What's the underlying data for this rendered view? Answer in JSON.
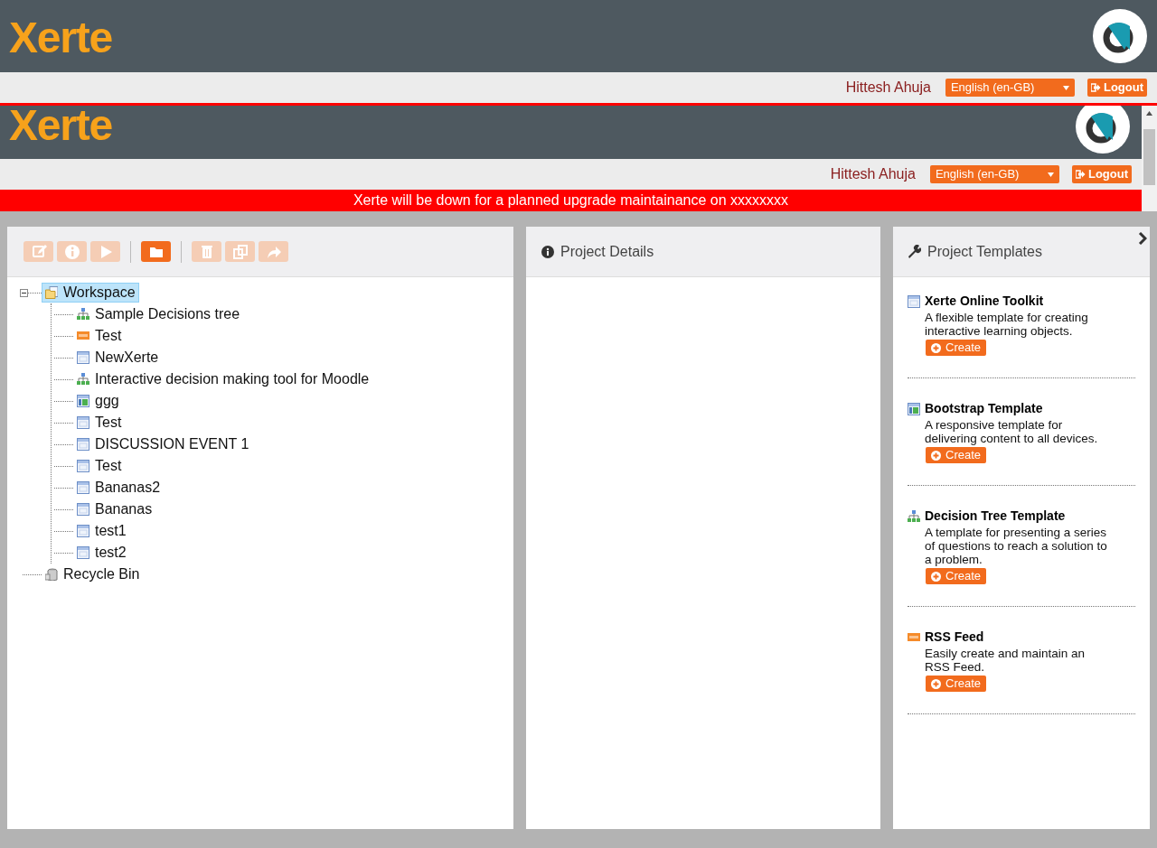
{
  "header": {
    "logo": "Xerte",
    "user": "Hittesh Ahuja",
    "language": "English (en-GB)",
    "logout": "Logout"
  },
  "embedded_header": {
    "logo": "Xerte",
    "user": "Hittesh Ahuja",
    "language": "English (en-GB)",
    "logout": "Logout",
    "banner": "Xerte will be down for a planned upgrade maintainance on xxxxxxxx"
  },
  "toolbar": [
    {
      "disabled": true
    },
    {
      "disabled": true
    },
    {
      "disabled": true
    },
    {
      "disabled": false
    },
    {
      "disabled": true
    },
    {
      "disabled": true
    },
    {
      "disabled": true
    }
  ],
  "tree": [
    {
      "label": "Workspace",
      "kind": "folder",
      "selected": true,
      "expanded": true,
      "children": [
        {
          "label": "Sample Decisions tree",
          "kind": "decision",
          "selected": false
        },
        {
          "label": "Test",
          "kind": "rss",
          "selected": false
        },
        {
          "label": "NewXerte",
          "kind": "xerte",
          "selected": false
        },
        {
          "label": "Interactive decision making tool for Moodle",
          "kind": "decision",
          "selected": false
        },
        {
          "label": "ggg",
          "kind": "bootstrap",
          "selected": false
        },
        {
          "label": "Test",
          "kind": "xerte",
          "selected": false
        },
        {
          "label": "DISCUSSION EVENT 1",
          "kind": "xerte",
          "selected": false
        },
        {
          "label": "Test",
          "kind": "xerte",
          "selected": false
        },
        {
          "label": "Bananas2",
          "kind": "xerte",
          "selected": false
        },
        {
          "label": "Bananas",
          "kind": "xerte",
          "selected": false
        },
        {
          "label": "test1",
          "kind": "xerte",
          "selected": false
        },
        {
          "label": "test2",
          "kind": "xerte",
          "selected": false
        }
      ]
    },
    {
      "label": "Recycle Bin",
      "kind": "bin",
      "selected": false
    }
  ],
  "details": {
    "title": "Project Details"
  },
  "templates": {
    "title": "Project Templates",
    "items": [
      {
        "name": "Xerte Online Toolkit",
        "kind": "xerte",
        "description": "A flexible template for creating interactive learning objects.",
        "button": "Create"
      },
      {
        "name": "Bootstrap Template",
        "kind": "bootstrap",
        "description": "A responsive template for delivering content to all devices.",
        "button": "Create"
      },
      {
        "name": "Decision Tree Template",
        "kind": "decision",
        "description": "A template for presenting a series of questions to reach a solution to a problem.",
        "button": "Create"
      },
      {
        "name": "RSS Feed",
        "kind": "rss",
        "description": "Easily create and maintain an RSS Feed.",
        "button": "Create"
      }
    ]
  }
}
